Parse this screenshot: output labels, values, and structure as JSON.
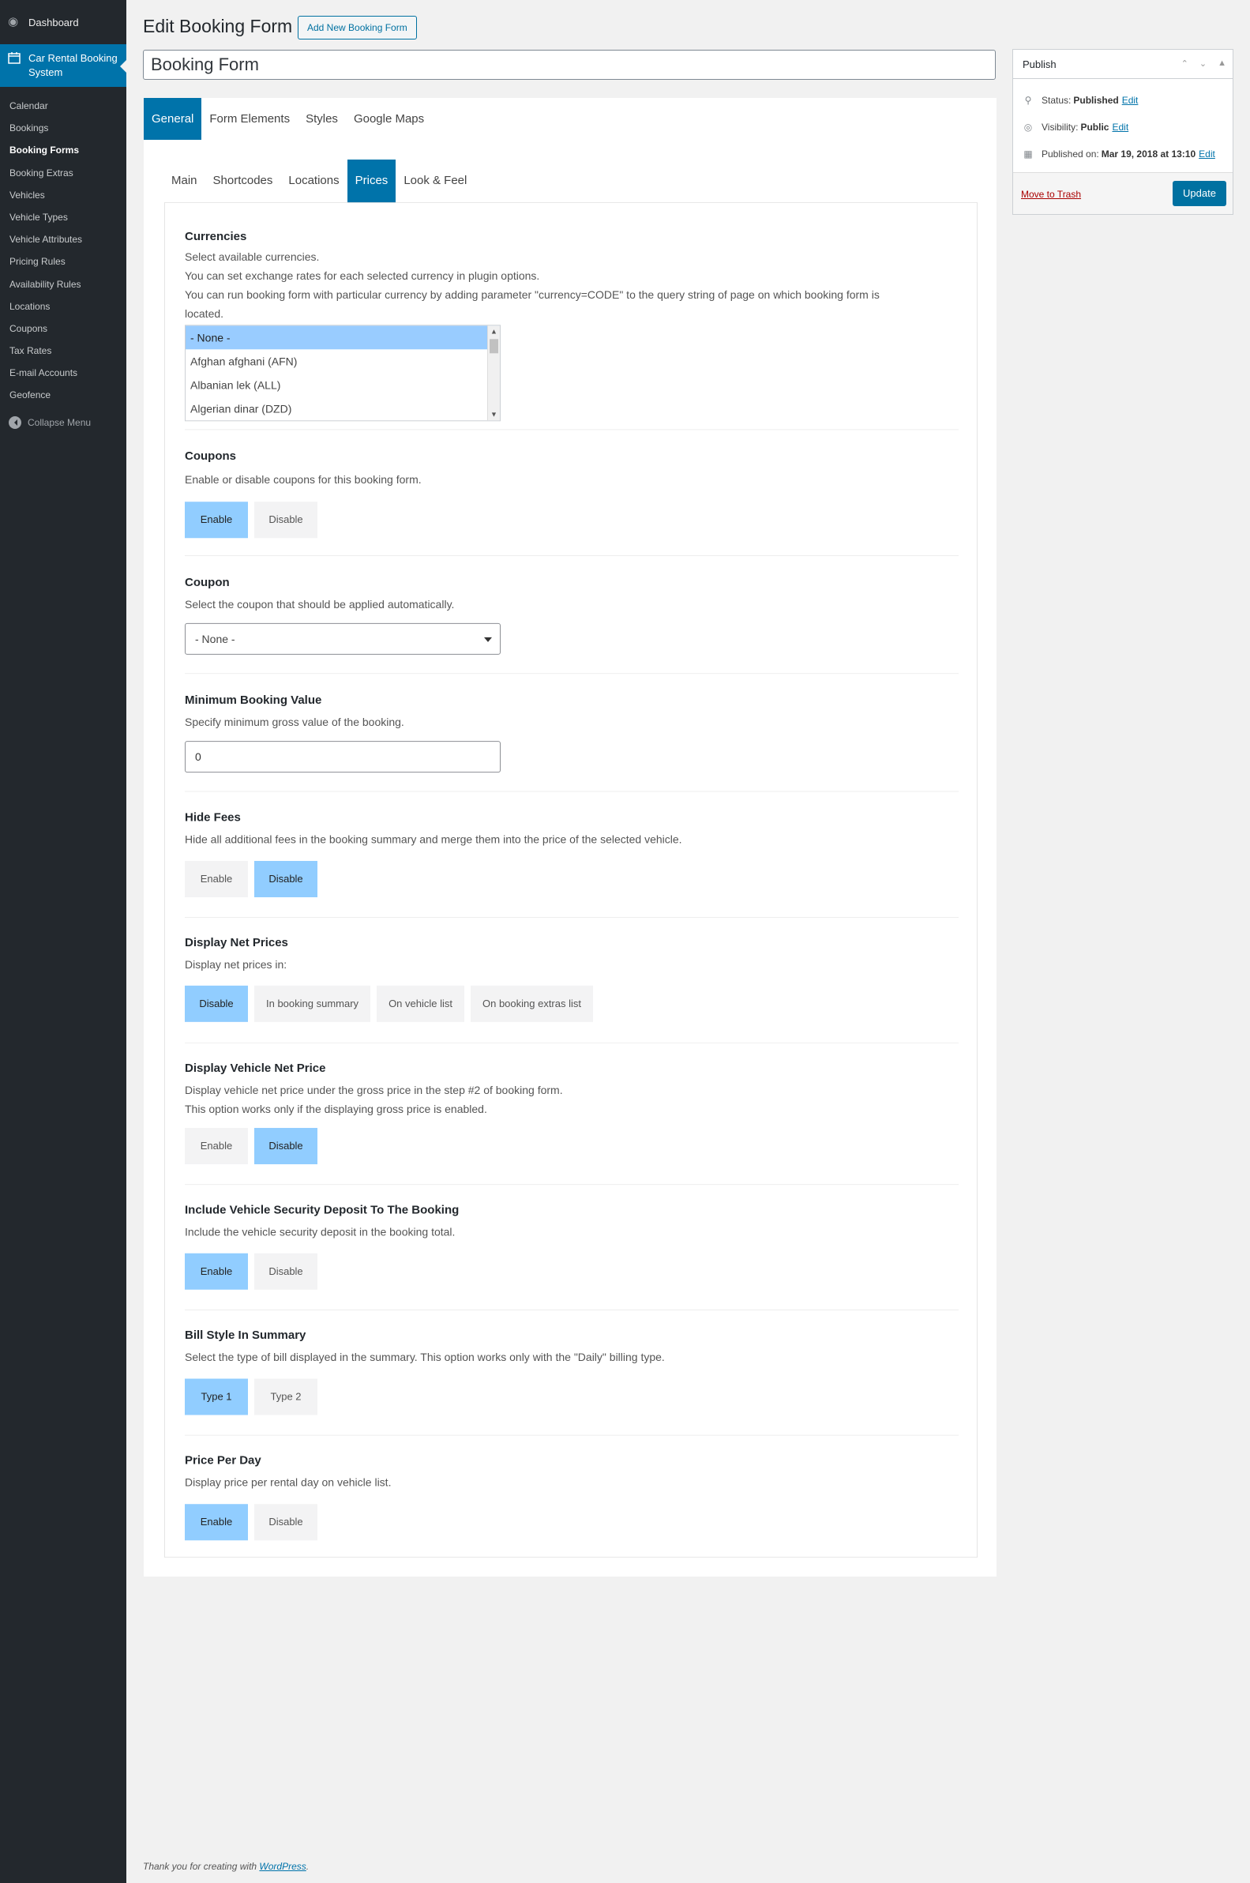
{
  "sidebar": {
    "dashboard": "Dashboard",
    "plugin": "Car Rental Booking System",
    "items": [
      "Calendar",
      "Bookings",
      "Booking Forms",
      "Booking Extras",
      "Vehicles",
      "Vehicle Types",
      "Vehicle Attributes",
      "Pricing Rules",
      "Availability Rules",
      "Locations",
      "Coupons",
      "Tax Rates",
      "E-mail Accounts",
      "Geofence"
    ],
    "current": "Booking Forms",
    "collapse": "Collapse Menu"
  },
  "header": {
    "title": "Edit Booking Form",
    "add_new": "Add New Booking Form"
  },
  "post_title": "Booking Form",
  "tabs_main": [
    "General",
    "Form Elements",
    "Styles",
    "Google Maps"
  ],
  "tabs_main_active": "General",
  "tabs_sub": [
    "Main",
    "Shortcodes",
    "Locations",
    "Prices",
    "Look & Feel"
  ],
  "tabs_sub_active": "Prices",
  "currencies": {
    "title": "Currencies",
    "desc1": "Select available currencies.",
    "desc2": "You can set exchange rates for each selected currency in plugin options.",
    "desc3": "You can run booking form with particular currency by adding parameter \"currency=CODE\" to the query string of page on which booking form is",
    "desc4": "located.",
    "options": [
      "- None -",
      "Afghan afghani (AFN)",
      "Albanian lek (ALL)",
      "Algerian dinar (DZD)"
    ],
    "selected": "- None -"
  },
  "coupons": {
    "title": "Coupons",
    "desc": "Enable or disable coupons for this booking form.",
    "enable": "Enable",
    "disable": "Disable",
    "active": "Enable"
  },
  "coupon": {
    "title": "Coupon",
    "desc": "Select the coupon that should be applied automatically.",
    "value": "- None -"
  },
  "min_value": {
    "title": "Minimum Booking Value",
    "desc": "Specify minimum gross value of the booking.",
    "value": "0"
  },
  "hide_fees": {
    "title": "Hide Fees",
    "desc": "Hide all additional fees in the booking summary and merge them into the price of the selected vehicle.",
    "enable": "Enable",
    "disable": "Disable",
    "active": "Disable"
  },
  "net_prices": {
    "title": "Display Net Prices",
    "desc": "Display net prices in:",
    "options": [
      "Disable",
      "In booking summary",
      "On vehicle list",
      "On booking extras list"
    ],
    "active": "Disable"
  },
  "vehicle_net": {
    "title": "Display Vehicle Net Price",
    "desc1": "Display vehicle net price under the gross price in the step #2 of booking form.",
    "desc2": "This option works only if the displaying gross price is enabled.",
    "enable": "Enable",
    "disable": "Disable",
    "active": "Disable"
  },
  "deposit": {
    "title": "Include Vehicle Security Deposit To The Booking",
    "desc": "Include the vehicle security deposit in the booking total.",
    "enable": "Enable",
    "disable": "Disable",
    "active": "Enable"
  },
  "bill_style": {
    "title": "Bill Style In Summary",
    "desc": "Select the type of bill displayed in the summary. This option works only with the \"Daily\" billing type.",
    "type1": "Type 1",
    "type2": "Type 2",
    "active": "Type 1"
  },
  "price_per_day": {
    "title": "Price Per Day",
    "desc": "Display price per rental day on vehicle list.",
    "enable": "Enable",
    "disable": "Disable",
    "active": "Enable"
  },
  "publish": {
    "title": "Publish",
    "status_label": "Status:",
    "status": "Published",
    "visibility_label": "Visibility:",
    "visibility": "Public",
    "published_label": "Published on:",
    "published": "Mar 19, 2018 at 13:10",
    "edit": "Edit",
    "trash": "Move to Trash",
    "update": "Update"
  },
  "footer": {
    "text": "Thank you for creating with",
    "link": "WordPress",
    "period": "."
  },
  "colors": {
    "sidebar": "#23282d",
    "accent": "#0073aa",
    "toggle_on": "#91cdff",
    "listbox_selected": "#99ccff"
  }
}
